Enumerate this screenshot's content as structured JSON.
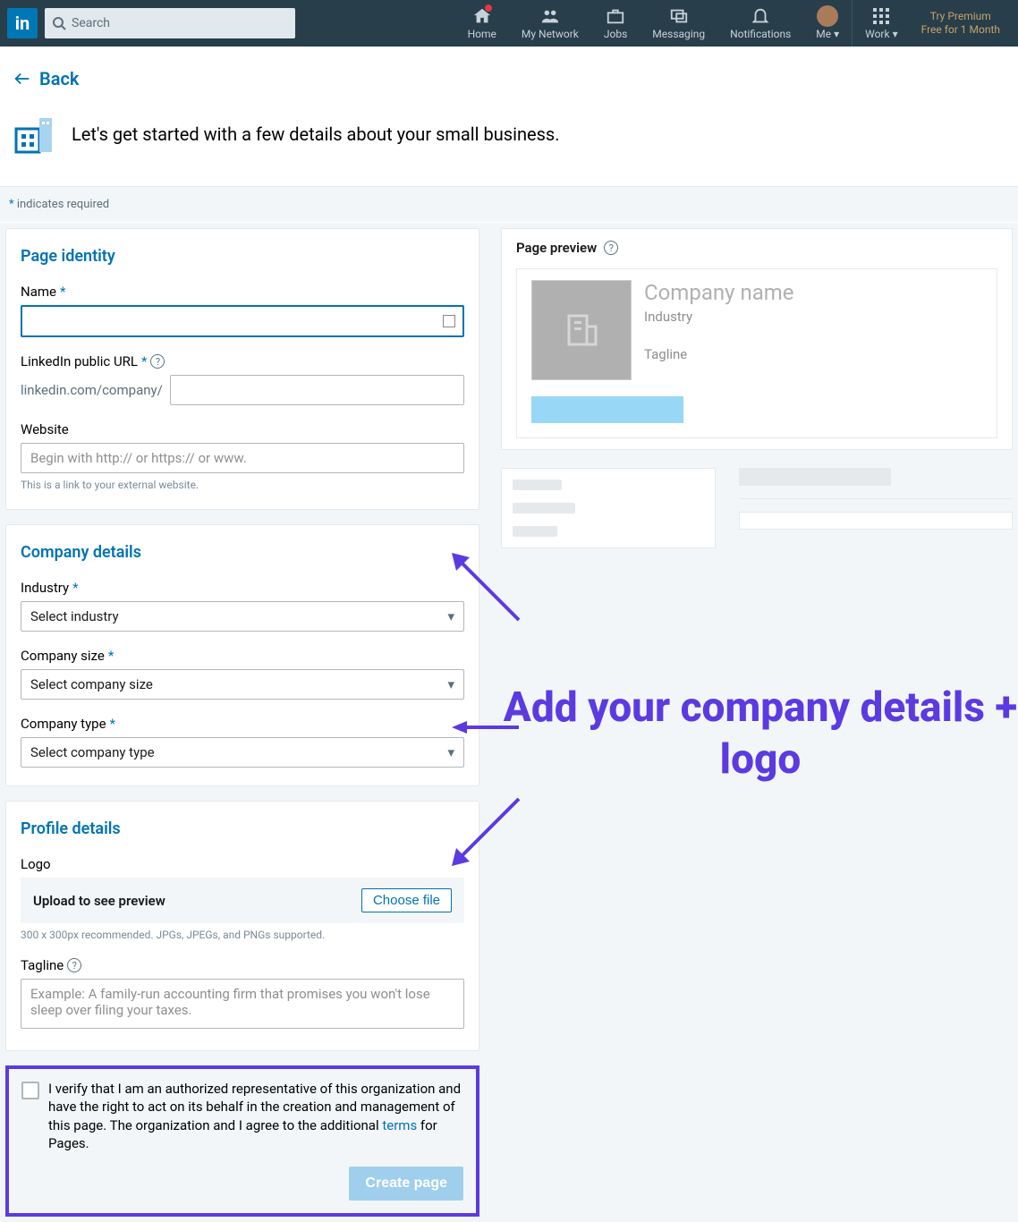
{
  "nav": {
    "search_placeholder": "Search",
    "home": "Home",
    "network": "My Network",
    "jobs": "Jobs",
    "messaging": "Messaging",
    "notifications": "Notifications",
    "me": "Me",
    "work": "Work",
    "premium_line1": "Try Premium",
    "premium_line2": "Free for 1 Month"
  },
  "back": "Back",
  "intro": "Let's get started with a few details about your small business.",
  "required_note": "indicates required",
  "identity": {
    "title": "Page identity",
    "name_label": "Name",
    "url_label": "LinkedIn public URL",
    "url_prefix": "linkedin.com/company/",
    "website_label": "Website",
    "website_placeholder": "Begin with http:// or https:// or www.",
    "website_hint": "This is a link to your external website."
  },
  "company": {
    "title": "Company details",
    "industry_label": "Industry",
    "industry_placeholder": "Select industry",
    "size_label": "Company size",
    "size_placeholder": "Select company size",
    "type_label": "Company type",
    "type_placeholder": "Select company type"
  },
  "profile": {
    "title": "Profile details",
    "logo_label": "Logo",
    "upload_text": "Upload to see preview",
    "choose_file": "Choose file",
    "logo_hint": "300 x 300px recommended. JPGs, JPEGs, and PNGs supported.",
    "tagline_label": "Tagline",
    "tagline_placeholder": "Example: A family-run accounting firm that promises you won't lose sleep over filing your taxes."
  },
  "verify": {
    "text_before": "I verify that I am an authorized representative of this organization and have the right to act on its behalf in the creation and management of this page. The organization and I agree to the additional ",
    "terms": "terms",
    "text_after": " for Pages.",
    "create": "Create page"
  },
  "preview": {
    "header": "Page preview",
    "company_name": "Company name",
    "industry": "Industry",
    "tagline": "Tagline"
  },
  "annotation": "Add your company details + logo"
}
